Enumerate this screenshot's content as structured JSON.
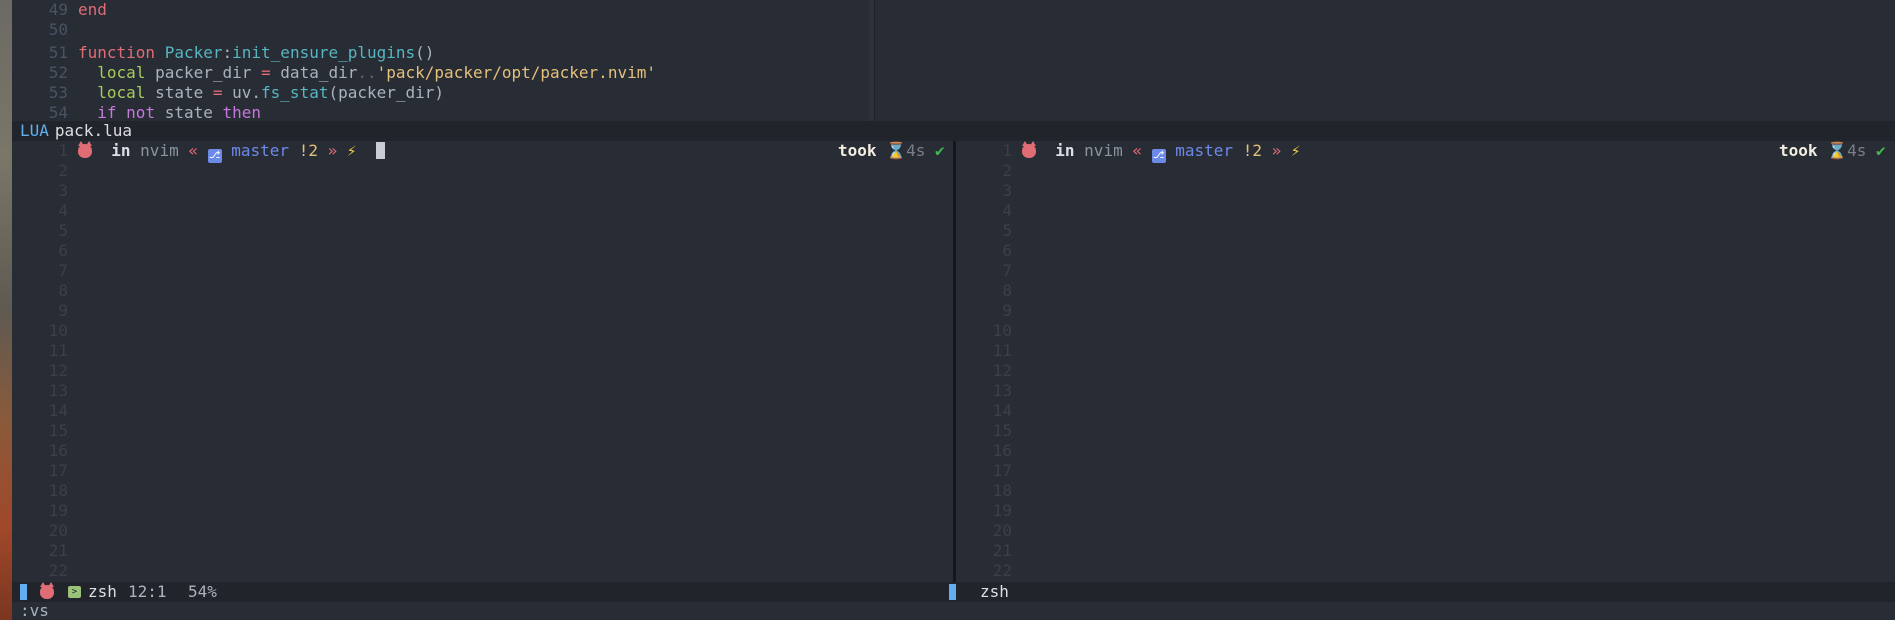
{
  "top_editor": {
    "code_lines": [
      {
        "num": "49",
        "segments": [
          {
            "t": "end",
            "c": "kwr"
          }
        ]
      },
      {
        "num": "50",
        "segments": []
      },
      {
        "num": "51",
        "segments": [
          {
            "t": "function ",
            "c": "kwr"
          },
          {
            "t": "Packer",
            "c": "op"
          },
          {
            "t": ":",
            "c": "plain"
          },
          {
            "t": "init_ensure_plugins",
            "c": "op"
          },
          {
            "t": "()",
            "c": "plain"
          }
        ]
      },
      {
        "num": "52",
        "segments": [
          {
            "t": "  local ",
            "c": "local"
          },
          {
            "t": "packer_dir ",
            "c": "plain"
          },
          {
            "t": "= ",
            "c": "kwr"
          },
          {
            "t": "data_dir",
            "c": "plain"
          },
          {
            "t": "..",
            "c": "dim"
          },
          {
            "t": "'pack/packer/opt/packer.nvim'",
            "c": "mod"
          }
        ]
      },
      {
        "num": "53",
        "segments": [
          {
            "t": "  local ",
            "c": "local"
          },
          {
            "t": "state ",
            "c": "plain"
          },
          {
            "t": "= ",
            "c": "kwr"
          },
          {
            "t": "uv",
            "c": "plain"
          },
          {
            "t": ".",
            "c": "plain"
          },
          {
            "t": "fs_stat",
            "c": "op"
          },
          {
            "t": "(packer_dir)",
            "c": "plain"
          }
        ]
      },
      {
        "num": "54",
        "segments": [
          {
            "t": "  if ",
            "c": "kw"
          },
          {
            "t": "not ",
            "c": "kw"
          },
          {
            "t": "state ",
            "c": "plain"
          },
          {
            "t": "then",
            "c": "kw"
          }
        ]
      }
    ]
  },
  "file_bar": {
    "filetype": "LUA",
    "filename": "pack.lua"
  },
  "terminal_left": {
    "prompt": {
      "in": "in",
      "dir": "nvim",
      "guill_open": "«",
      "branch": "master",
      "status": "!2",
      "guill_close": "»",
      "bolt": "⚡"
    },
    "rprompt": {
      "took": "took",
      "hourglass": "⌛",
      "duration": "4s",
      "check": "✔"
    },
    "line_numbers": [
      "1",
      "2",
      "3",
      "4",
      "5",
      "6",
      "7",
      "8",
      "9",
      "10",
      "11",
      "12",
      "13",
      "14",
      "15",
      "16",
      "17",
      "18",
      "19",
      "20",
      "21",
      "22"
    ]
  },
  "terminal_right": {
    "prompt": {
      "in": "in",
      "dir": "nvim",
      "guill_open": "«",
      "branch": "master",
      "status": "!2",
      "guill_close": "»",
      "bolt": "⚡"
    },
    "rprompt": {
      "took": "took",
      "hourglass": "⌛",
      "duration": "4s",
      "check": "✔"
    },
    "line_numbers": [
      "1",
      "2",
      "3",
      "4",
      "5",
      "6",
      "7",
      "8",
      "9",
      "10",
      "11",
      "12",
      "13",
      "14",
      "15",
      "16",
      "17",
      "18",
      "19",
      "20",
      "21",
      "22"
    ]
  },
  "statusline": {
    "left": {
      "name": "zsh",
      "position": "12:1",
      "percent": "54%"
    },
    "right": {
      "name": "zsh"
    }
  },
  "cmdline": ":vs",
  "colors": {
    "accent": "#61afef",
    "background": "#282c34",
    "error": "#e06c75"
  }
}
